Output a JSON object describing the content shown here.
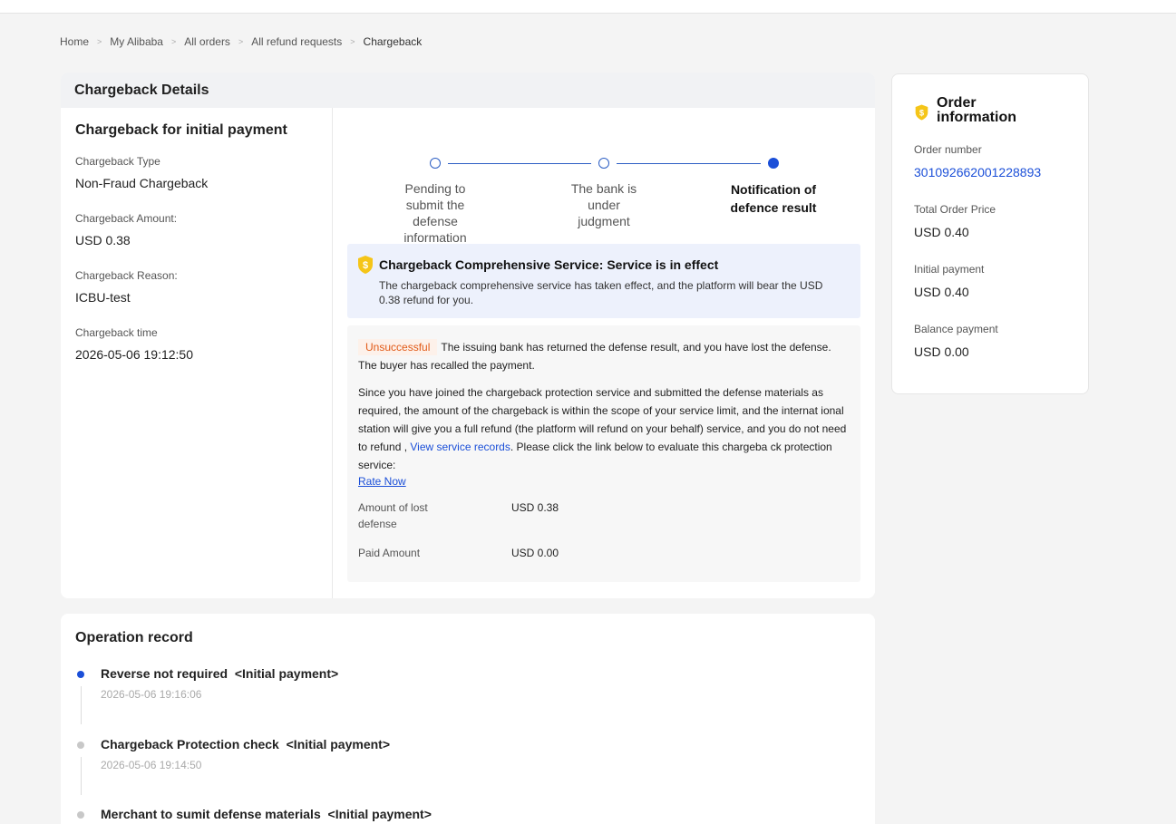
{
  "breadcrumb": {
    "items": [
      "Home",
      "My Alibaba",
      "All orders",
      "All refund requests"
    ],
    "current": "Chargeback"
  },
  "details": {
    "header": "Chargeback Details",
    "section_title": "Chargeback for initial payment",
    "fields": [
      {
        "label": "Chargeback Type",
        "value": "Non-Fraud Chargeback"
      },
      {
        "label": "Chargeback Amount:",
        "value": "USD 0.38"
      },
      {
        "label": "Chargeback Reason:",
        "value": "ICBU-test"
      },
      {
        "label": "Chargeback time",
        "value": "2026-05-06 19:12:50"
      }
    ],
    "steps": [
      {
        "label": "Pending to submit the defense information",
        "active": false
      },
      {
        "label": "The bank is under judgment",
        "active": false
      },
      {
        "label": "Notification of defence result",
        "active": true
      }
    ],
    "service": {
      "title": "Chargeback Comprehensive Service:  Service is in effect",
      "description": "The chargeback comprehensive service has taken effect, and the platform will bear the USD 0.38 refund for you."
    },
    "result": {
      "status": "Unsuccessful",
      "status_text": "The issuing bank has returned the defense result, and you have lost the defense. The buyer has recalled the payment.",
      "para_before_link": "Since you have joined the chargeback protection service and submitted the defense materials as required, the amount of the chargeback is within the scope of your service limit, and the internat ional station will give you a full refund (the platform will refund on your behalf) service, and you do not need to refund , ",
      "link_text": "View service records",
      "para_after_link": ". Please click the link below to evaluate this chargeba ck protection service:",
      "rate_link": "Rate Now",
      "amounts": [
        {
          "label": "Amount of lost defense",
          "value": "USD 0.38"
        },
        {
          "label": "Paid Amount",
          "value": "USD 0.00"
        }
      ]
    }
  },
  "order": {
    "title": "Order information",
    "number_label": "Order number",
    "number": "301092662001228893",
    "fields": [
      {
        "label": "Total Order Price",
        "value": "USD 0.40"
      },
      {
        "label": "Initial payment",
        "value": "USD 0.40"
      },
      {
        "label": "Balance payment",
        "value": "USD 0.00"
      }
    ]
  },
  "operations": {
    "title": "Operation record",
    "items": [
      {
        "title": "Reverse not required  <Initial payment>",
        "time": "2026-05-06 19:16:06",
        "active": true
      },
      {
        "title": "Chargeback Protection check  <Initial payment>",
        "time": "2026-05-06 19:14:50",
        "active": false
      },
      {
        "title": "Merchant to sumit defense materials  <Initial payment>",
        "time": "",
        "active": false
      }
    ]
  },
  "colors": {
    "accent": "#1b4fd8",
    "status_failed": "#e15a17",
    "service_bg": "#edf1fc",
    "badge": "#f5c518"
  }
}
